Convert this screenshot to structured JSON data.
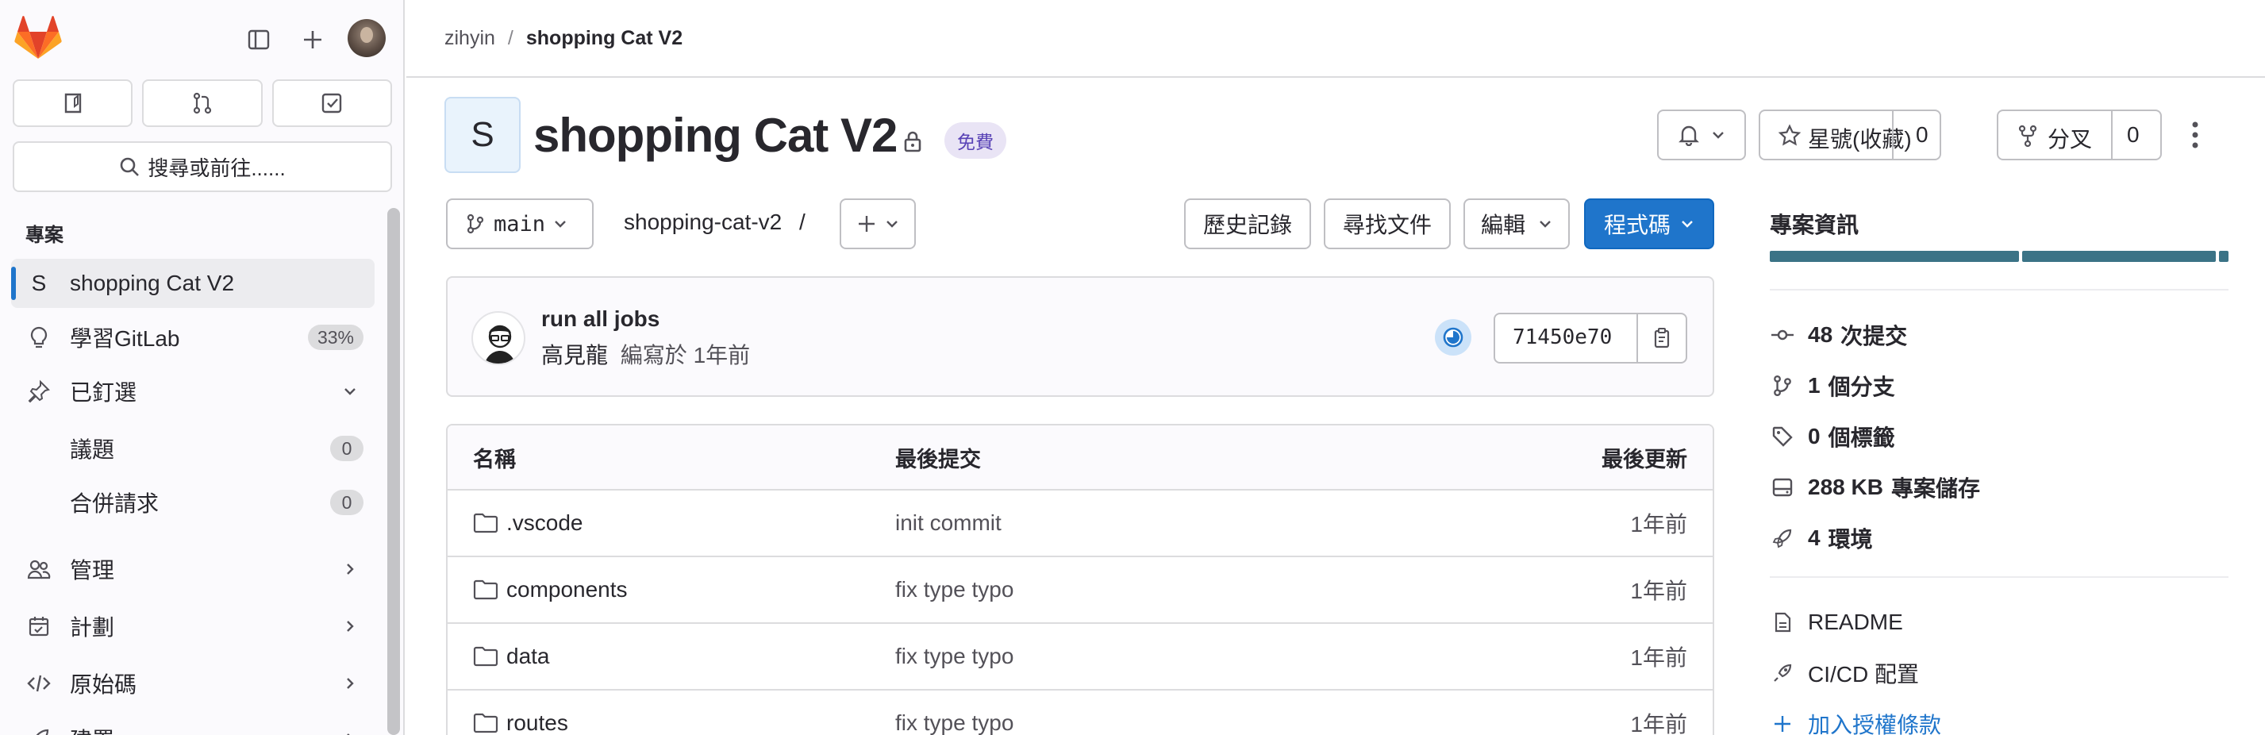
{
  "breadcrumb": {
    "owner": "zihyin",
    "separator": "/",
    "project": "shopping Cat V2"
  },
  "sidebar": {
    "search_label": "搜尋或前往......",
    "section_title": "專案",
    "items": [
      {
        "label": "shopping Cat V2",
        "icon": "S",
        "active": true
      },
      {
        "label": "學習GitLab",
        "count": "33%"
      },
      {
        "label": "已釘選"
      },
      {
        "label": "議題",
        "count": "0"
      },
      {
        "label": "合併請求",
        "count": "0"
      },
      {
        "label": "管理"
      },
      {
        "label": "計劃"
      },
      {
        "label": "原始碼"
      },
      {
        "label": "建置"
      }
    ]
  },
  "project": {
    "avatar_letter": "S",
    "title": "shopping Cat V2",
    "tier_badge": "免費",
    "star_label": "星號(收藏)",
    "star_count": "0",
    "fork_label": "分叉",
    "fork_count": "0"
  },
  "repo_toolbar": {
    "branch": "main",
    "path": "shopping-cat-v2",
    "path_sep": "/",
    "history": "歷史記錄",
    "find_file": "尋找文件",
    "edit": "編輯",
    "code": "程式碼"
  },
  "last_commit": {
    "title": "run all jobs",
    "author": "高見龍",
    "meta": "編寫於 1年前",
    "sha": "71450e70"
  },
  "file_table": {
    "headers": {
      "name": "名稱",
      "last_commit": "最後提交",
      "last_update": "最後更新"
    },
    "rows": [
      {
        "name": ".vscode",
        "commit": "init commit",
        "updated": "1年前"
      },
      {
        "name": "components",
        "commit": "fix type typo",
        "updated": "1年前"
      },
      {
        "name": "data",
        "commit": "fix type typo",
        "updated": "1年前"
      },
      {
        "name": "routes",
        "commit": "fix type typo",
        "updated": "1年前"
      }
    ]
  },
  "project_info": {
    "title": "專案資訊",
    "language_bar_colors": [
      "#3b7386",
      "#3b7386",
      "#3b7386"
    ],
    "stats": [
      {
        "value": "48",
        "label": "次提交",
        "icon": "commit-icon"
      },
      {
        "value": "1",
        "label": "個分支",
        "icon": "branch-icon"
      },
      {
        "value": "0",
        "label": "個標籤",
        "icon": "tag-icon"
      },
      {
        "value": "288 KB",
        "label": "專案儲存",
        "icon": "storage-icon"
      },
      {
        "value": "4",
        "label": "環境",
        "icon": "environment-icon"
      }
    ],
    "links": [
      {
        "label": "README",
        "icon": "file-icon"
      },
      {
        "label": "CI/CD 配置",
        "icon": "rocket-icon"
      },
      {
        "label": "加入授權條款",
        "icon": "plus-icon"
      }
    ]
  },
  "colors": {
    "primary": "#1f75cb",
    "badge_bg": "#e9e4f5",
    "badge_text": "#5943b6",
    "lang_bar": "#3b7386"
  }
}
